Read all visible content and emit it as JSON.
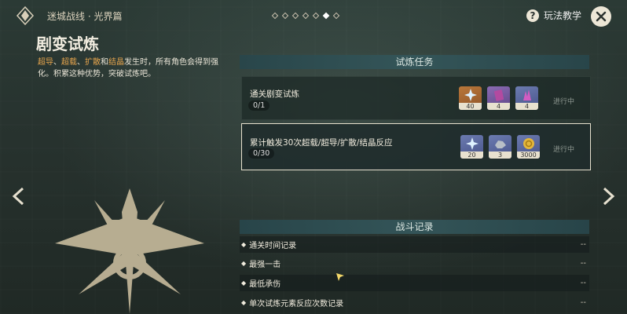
{
  "header": {
    "breadcrumb": "迷城战线 · 光界篇",
    "page_dots": [
      false,
      false,
      false,
      false,
      false,
      true,
      false
    ],
    "help_label": "玩法教学"
  },
  "intro": {
    "title": "剧变试炼",
    "desc_parts": {
      "r1": "超导",
      "sep1": "、",
      "r2": "超载",
      "sep2": "、",
      "r3": "扩散",
      "and": "和",
      "r4": "结晶",
      "rest": "发生时，所有角色会得到强化。积累这种优势，突破试炼吧。"
    }
  },
  "tasks": {
    "header": "试炼任务",
    "items": [
      {
        "name": "通关剧变试炼",
        "progress": "0/1",
        "status": "进行中",
        "rewards": [
          {
            "icon": "primogem-icon",
            "count": "40"
          },
          {
            "icon": "purple-book-icon",
            "count": "4"
          },
          {
            "icon": "crystal-icon",
            "count": "4"
          }
        ]
      },
      {
        "name": "累计触发30次超载/超导/扩散/结晶反应",
        "progress": "0/30",
        "status": "进行中",
        "rewards": [
          {
            "icon": "primogem-icon",
            "count": "20"
          },
          {
            "icon": "ore-icon",
            "count": "3"
          },
          {
            "icon": "mora-icon",
            "count": "3000"
          }
        ]
      }
    ]
  },
  "records": {
    "header": "战斗记录",
    "items": [
      {
        "label": "通关时间记录",
        "value": "--"
      },
      {
        "label": "最强一击",
        "value": "--"
      },
      {
        "label": "最低承伤",
        "value": "--"
      },
      {
        "label": "单次试炼元素反应次数记录",
        "value": "--"
      }
    ]
  },
  "colors": {
    "accent": "#e7a54d",
    "panel": "#2b4a4e"
  }
}
